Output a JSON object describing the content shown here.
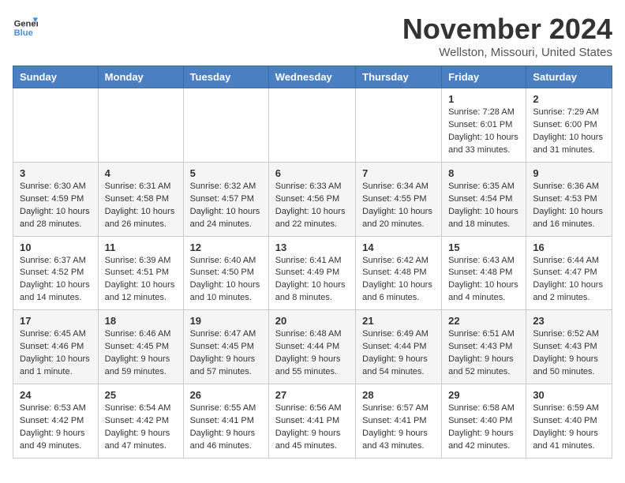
{
  "header": {
    "logo_line1": "General",
    "logo_line2": "Blue",
    "month_title": "November 2024",
    "location": "Wellston, Missouri, United States"
  },
  "columns": [
    "Sunday",
    "Monday",
    "Tuesday",
    "Wednesday",
    "Thursday",
    "Friday",
    "Saturday"
  ],
  "weeks": [
    [
      {
        "day": "",
        "info": ""
      },
      {
        "day": "",
        "info": ""
      },
      {
        "day": "",
        "info": ""
      },
      {
        "day": "",
        "info": ""
      },
      {
        "day": "",
        "info": ""
      },
      {
        "day": "1",
        "info": "Sunrise: 7:28 AM\nSunset: 6:01 PM\nDaylight: 10 hours and 33 minutes."
      },
      {
        "day": "2",
        "info": "Sunrise: 7:29 AM\nSunset: 6:00 PM\nDaylight: 10 hours and 31 minutes."
      }
    ],
    [
      {
        "day": "3",
        "info": "Sunrise: 6:30 AM\nSunset: 4:59 PM\nDaylight: 10 hours and 28 minutes."
      },
      {
        "day": "4",
        "info": "Sunrise: 6:31 AM\nSunset: 4:58 PM\nDaylight: 10 hours and 26 minutes."
      },
      {
        "day": "5",
        "info": "Sunrise: 6:32 AM\nSunset: 4:57 PM\nDaylight: 10 hours and 24 minutes."
      },
      {
        "day": "6",
        "info": "Sunrise: 6:33 AM\nSunset: 4:56 PM\nDaylight: 10 hours and 22 minutes."
      },
      {
        "day": "7",
        "info": "Sunrise: 6:34 AM\nSunset: 4:55 PM\nDaylight: 10 hours and 20 minutes."
      },
      {
        "day": "8",
        "info": "Sunrise: 6:35 AM\nSunset: 4:54 PM\nDaylight: 10 hours and 18 minutes."
      },
      {
        "day": "9",
        "info": "Sunrise: 6:36 AM\nSunset: 4:53 PM\nDaylight: 10 hours and 16 minutes."
      }
    ],
    [
      {
        "day": "10",
        "info": "Sunrise: 6:37 AM\nSunset: 4:52 PM\nDaylight: 10 hours and 14 minutes."
      },
      {
        "day": "11",
        "info": "Sunrise: 6:39 AM\nSunset: 4:51 PM\nDaylight: 10 hours and 12 minutes."
      },
      {
        "day": "12",
        "info": "Sunrise: 6:40 AM\nSunset: 4:50 PM\nDaylight: 10 hours and 10 minutes."
      },
      {
        "day": "13",
        "info": "Sunrise: 6:41 AM\nSunset: 4:49 PM\nDaylight: 10 hours and 8 minutes."
      },
      {
        "day": "14",
        "info": "Sunrise: 6:42 AM\nSunset: 4:48 PM\nDaylight: 10 hours and 6 minutes."
      },
      {
        "day": "15",
        "info": "Sunrise: 6:43 AM\nSunset: 4:48 PM\nDaylight: 10 hours and 4 minutes."
      },
      {
        "day": "16",
        "info": "Sunrise: 6:44 AM\nSunset: 4:47 PM\nDaylight: 10 hours and 2 minutes."
      }
    ],
    [
      {
        "day": "17",
        "info": "Sunrise: 6:45 AM\nSunset: 4:46 PM\nDaylight: 10 hours and 1 minute."
      },
      {
        "day": "18",
        "info": "Sunrise: 6:46 AM\nSunset: 4:45 PM\nDaylight: 9 hours and 59 minutes."
      },
      {
        "day": "19",
        "info": "Sunrise: 6:47 AM\nSunset: 4:45 PM\nDaylight: 9 hours and 57 minutes."
      },
      {
        "day": "20",
        "info": "Sunrise: 6:48 AM\nSunset: 4:44 PM\nDaylight: 9 hours and 55 minutes."
      },
      {
        "day": "21",
        "info": "Sunrise: 6:49 AM\nSunset: 4:44 PM\nDaylight: 9 hours and 54 minutes."
      },
      {
        "day": "22",
        "info": "Sunrise: 6:51 AM\nSunset: 4:43 PM\nDaylight: 9 hours and 52 minutes."
      },
      {
        "day": "23",
        "info": "Sunrise: 6:52 AM\nSunset: 4:43 PM\nDaylight: 9 hours and 50 minutes."
      }
    ],
    [
      {
        "day": "24",
        "info": "Sunrise: 6:53 AM\nSunset: 4:42 PM\nDaylight: 9 hours and 49 minutes."
      },
      {
        "day": "25",
        "info": "Sunrise: 6:54 AM\nSunset: 4:42 PM\nDaylight: 9 hours and 47 minutes."
      },
      {
        "day": "26",
        "info": "Sunrise: 6:55 AM\nSunset: 4:41 PM\nDaylight: 9 hours and 46 minutes."
      },
      {
        "day": "27",
        "info": "Sunrise: 6:56 AM\nSunset: 4:41 PM\nDaylight: 9 hours and 45 minutes."
      },
      {
        "day": "28",
        "info": "Sunrise: 6:57 AM\nSunset: 4:41 PM\nDaylight: 9 hours and 43 minutes."
      },
      {
        "day": "29",
        "info": "Sunrise: 6:58 AM\nSunset: 4:40 PM\nDaylight: 9 hours and 42 minutes."
      },
      {
        "day": "30",
        "info": "Sunrise: 6:59 AM\nSunset: 4:40 PM\nDaylight: 9 hours and 41 minutes."
      }
    ]
  ]
}
